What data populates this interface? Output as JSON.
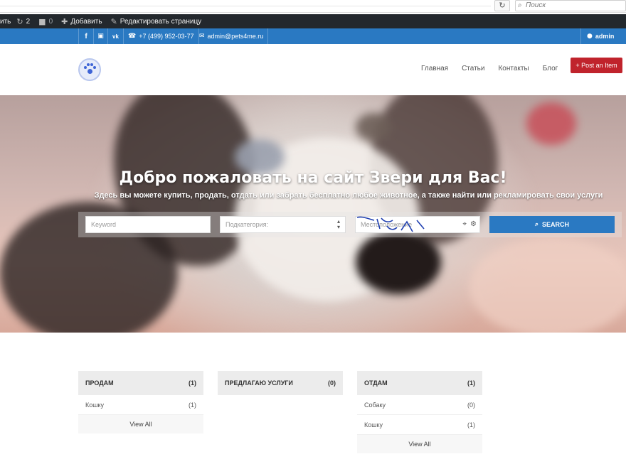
{
  "browser": {
    "search_placeholder": "Поиск",
    "refresh_icon": "refresh-icon"
  },
  "admin_bar": {
    "items": [
      {
        "label": "ить",
        "icon": ""
      },
      {
        "label": "2",
        "icon": "updates-icon"
      },
      {
        "label": "0",
        "icon": "comments-icon"
      },
      {
        "label": "Добавить",
        "icon": "plus-icon"
      },
      {
        "label": "Редактировать страницу",
        "icon": "pencil-icon"
      }
    ]
  },
  "contact_bar": {
    "social": [
      "f",
      "ig",
      "vk"
    ],
    "phone": "+7 (499) 952-03-77",
    "email": "admin@pets4me.ru",
    "user": "admin"
  },
  "header": {
    "nav": [
      "Главная",
      "Статьи",
      "Контакты",
      "Блог"
    ],
    "post_button": "+ Post an Item"
  },
  "hero": {
    "title": "Добро пожаловать на сайт Звери для Вас!",
    "subtitle": "Здесь вы можете купить, продать, отдать или забрать бесплатно любое животное, а также найти или рекламировать свои услуги",
    "keyword_placeholder": "Keyword",
    "subcategory_placeholder": "Подкатегория:",
    "location_placeholder": "Местоположение",
    "search_button": "SEARCH"
  },
  "categories": [
    {
      "title": "ПРОДАМ",
      "count": "(1)",
      "items": [
        {
          "name": "Кошку",
          "count": "(1)"
        }
      ],
      "view_all": "View All"
    },
    {
      "title": "ПРЕДЛАГАЮ УСЛУГИ",
      "count": "(0)",
      "items": [],
      "view_all": ""
    },
    {
      "title": "ОТДАМ",
      "count": "(1)",
      "items": [
        {
          "name": "Собаку",
          "count": "(0)"
        },
        {
          "name": "Кошку",
          "count": "(1)"
        }
      ],
      "view_all": "View All"
    }
  ],
  "colors": {
    "admin_bar": "#23282d",
    "brand_blue": "#2a79c2",
    "post_red": "#c0232c"
  }
}
